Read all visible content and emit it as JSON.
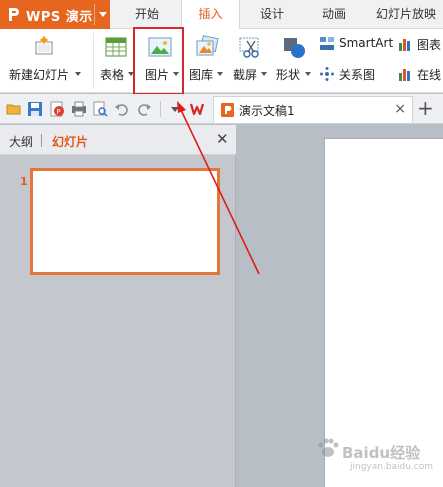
{
  "app": {
    "title": "WPS 演示"
  },
  "tabs": [
    {
      "label": "开始",
      "active": false
    },
    {
      "label": "插入",
      "active": true
    },
    {
      "label": "设计",
      "active": false
    },
    {
      "label": "动画",
      "active": false
    },
    {
      "label": "幻灯片放映",
      "active": false
    }
  ],
  "ribbon": {
    "new_slide": "新建幻灯片",
    "table": "表格",
    "picture": "图片",
    "gallery": "图库",
    "screenshot": "截屏",
    "shapes": "形状",
    "relation": "关系图",
    "smartart": "SmartArt",
    "chart": "图表",
    "online": "在线"
  },
  "document": {
    "tab_title": "演示文稿1"
  },
  "panel": {
    "outline_tab": "大纲",
    "slides_tab": "幻灯片",
    "slide_number": "1"
  },
  "watermark": {
    "text": "Baidu经验",
    "sub": "jingyan.baidu.com"
  },
  "colors": {
    "accent": "#e7661f",
    "highlight": "#d9262c",
    "arrow": "#e01c1c"
  }
}
